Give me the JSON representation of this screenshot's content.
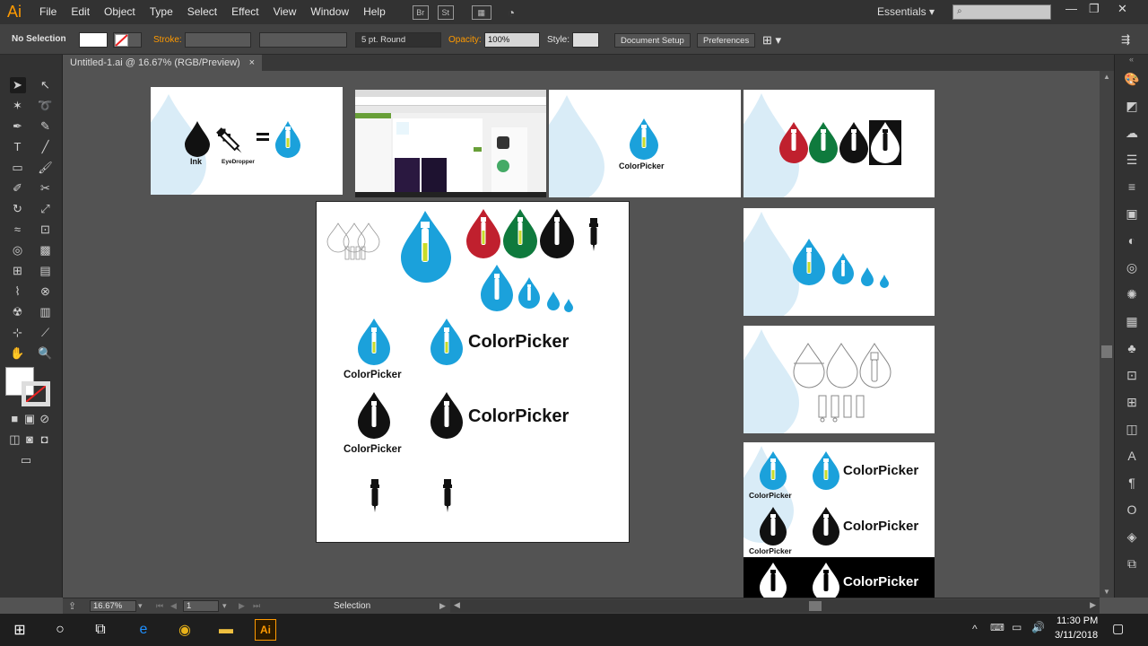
{
  "app": {
    "logo": "Ai"
  },
  "menu": [
    "File",
    "Edit",
    "Object",
    "Type",
    "Select",
    "Effect",
    "View",
    "Window",
    "Help"
  ],
  "menubar_icons": [
    "Br",
    "St"
  ],
  "workspace": {
    "label": "Essentials"
  },
  "control_bar": {
    "selection": "No Selection",
    "stroke_label": "Stroke:",
    "brush": "5 pt. Round",
    "opacity_label": "Opacity:",
    "opacity_value": "100%",
    "style_label": "Style:",
    "doc_setup": "Document Setup",
    "preferences": "Preferences"
  },
  "document_tab": {
    "title": "Untitled-1.ai @ 16.67% (RGB/Preview)"
  },
  "artwork": {
    "ink": "Ink",
    "eyedropper": "EyeDropper",
    "brand_name": "ColorPicker",
    "colors": {
      "cyan": "#1ba1db",
      "red": "#c0202e",
      "green": "#0f7a3d",
      "black": "#111111",
      "tube": "#c8dc2a"
    }
  },
  "status": {
    "zoom": "16.67%",
    "page": "1",
    "tool": "Selection"
  },
  "taskbar": {
    "time": "11:30 PM",
    "date": "3/11/2018"
  }
}
